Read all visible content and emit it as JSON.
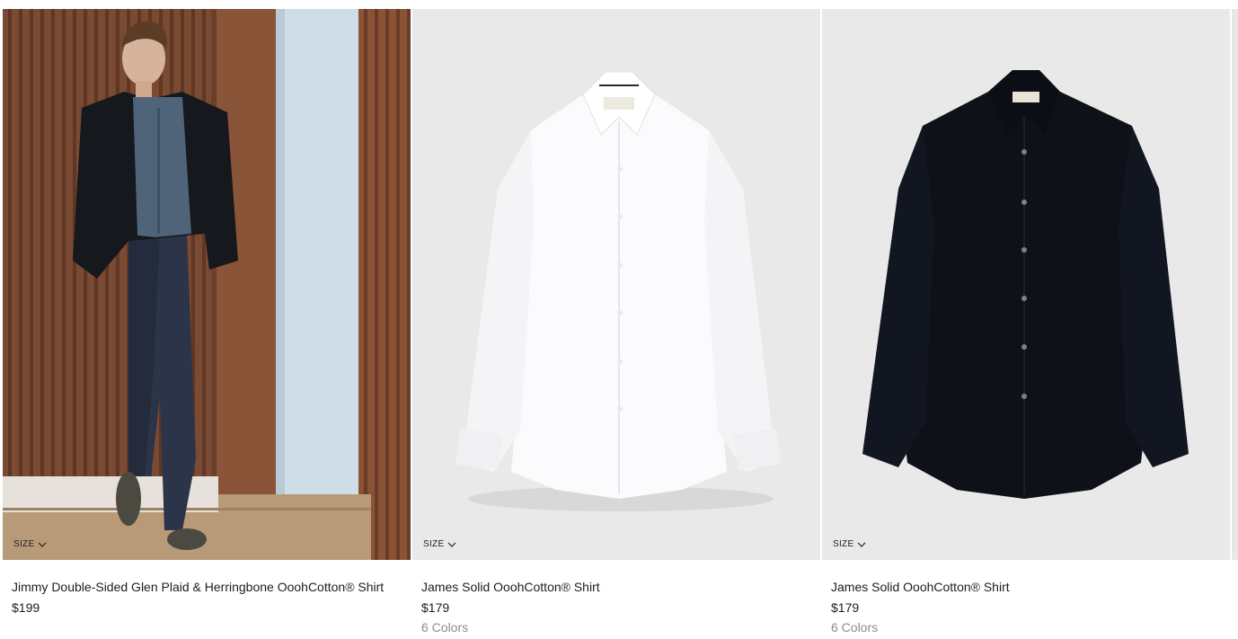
{
  "products": [
    {
      "name": "Jimmy Double-Sided Glen Plaid & Herringbone OoohCotton® Shirt",
      "price": "$199",
      "colors": "",
      "size_label": "SIZE"
    },
    {
      "name": "James Solid OoohCotton® Shirt",
      "price": "$179",
      "colors": "6 Colors",
      "size_label": "SIZE"
    },
    {
      "name": "James Solid OoohCotton® Shirt",
      "price": "$179",
      "colors": "6 Colors",
      "size_label": "SIZE"
    }
  ],
  "icons": {
    "size_toggle": "chevron-down-icon"
  },
  "colors": {
    "image_bg": "#e9e9e9",
    "text_primary": "#1d1d1d",
    "text_muted": "#8c8c8c"
  }
}
